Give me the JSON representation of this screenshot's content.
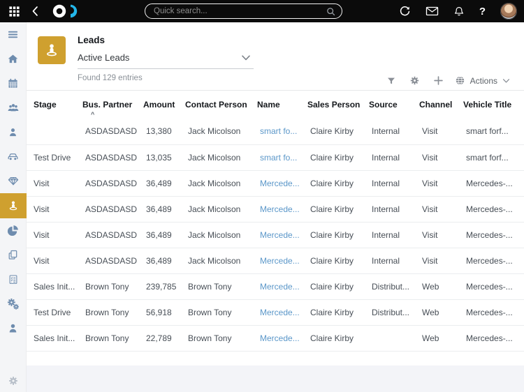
{
  "topbar": {
    "search_placeholder": "Quick search...",
    "help_label": "?"
  },
  "header": {
    "title": "Leads",
    "view": "Active Leads",
    "result_count": "Found 129 entries",
    "actions_label": "Actions"
  },
  "table": {
    "columns": [
      "Stage",
      "Bus. Partner",
      "Amount",
      "Contact Person",
      "Name",
      "Sales Person",
      "Source",
      "Channel",
      "Vehicle Title"
    ],
    "sort": {
      "column": "Bus. Partner",
      "direction": "asc",
      "indicator": "^"
    },
    "rows": [
      [
        "",
        "ASDASDASD",
        "13,380",
        "Jack Micolson",
        "smart fo...",
        "Claire Kirby",
        "Internal",
        "Visit",
        "smart forf..."
      ],
      [
        "Test Drive",
        "ASDASDASD",
        "13,035",
        "Jack Micolson",
        "smart fo...",
        "Claire Kirby",
        "Internal",
        "Visit",
        "smart forf..."
      ],
      [
        "Visit",
        "ASDASDASD",
        "36,489",
        "Jack Micolson",
        "Mercede...",
        "Claire Kirby",
        "Internal",
        "Visit",
        "Mercedes-..."
      ],
      [
        "Visit",
        "ASDASDASD",
        "36,489",
        "Jack Micolson",
        "Mercede...",
        "Claire Kirby",
        "Internal",
        "Visit",
        "Mercedes-..."
      ],
      [
        "Visit",
        "ASDASDASD",
        "36,489",
        "Jack Micolson",
        "Mercede...",
        "Claire Kirby",
        "Internal",
        "Visit",
        "Mercedes-..."
      ],
      [
        "Visit",
        "ASDASDASD",
        "36,489",
        "Jack Micolson",
        "Mercede...",
        "Claire Kirby",
        "Internal",
        "Visit",
        "Mercedes-..."
      ],
      [
        "Sales Init...",
        "Brown Tony",
        "239,785",
        "Brown Tony",
        "Mercede...",
        "Claire Kirby",
        "Distribut...",
        "Web",
        "Mercedes-..."
      ],
      [
        "Test Drive",
        "Brown Tony",
        "56,918",
        "Brown Tony",
        "Mercede...",
        "Claire Kirby",
        "Distribut...",
        "Web",
        "Mercedes-..."
      ],
      [
        "Sales Init...",
        "Brown Tony",
        "22,789",
        "Brown Tony",
        "Mercede...",
        "Claire Kirby",
        "",
        "Web",
        "Mercedes-..."
      ]
    ],
    "column_keys": [
      "stage",
      "bus-partner",
      "amount",
      "contact-person",
      "name",
      "sales-person",
      "source",
      "channel",
      "vehicle-title"
    ],
    "link_column_index": 4
  },
  "colors": {
    "topbar_bg": "#0b0b0b",
    "accent_gold": "#cfa02f",
    "link_blue": "#5b97c9",
    "brand_cyan": "#23b6e9",
    "sidebar_icon": "#6e8cae"
  },
  "icons": {
    "topbar": [
      "apps-grid-icon",
      "back-icon",
      "brand-logo",
      "search-icon",
      "refresh-icon",
      "mail-icon",
      "notifications-bell-icon",
      "help-icon",
      "user-avatar"
    ],
    "sidebar": [
      "menu-icon",
      "home-icon",
      "calendar-icon",
      "customers-icon",
      "contact-icon",
      "vehicles-icon",
      "deals-diamond-icon",
      "leads-icon",
      "reports-pie-icon",
      "duplicates-icon",
      "tasks-checklist-icon",
      "automation-cogs-icon",
      "users-icon",
      "settings-gear-icon"
    ],
    "head_actions": [
      "filter-icon",
      "gear-icon",
      "add-icon",
      "globe-icon",
      "chevron-down-icon"
    ]
  }
}
